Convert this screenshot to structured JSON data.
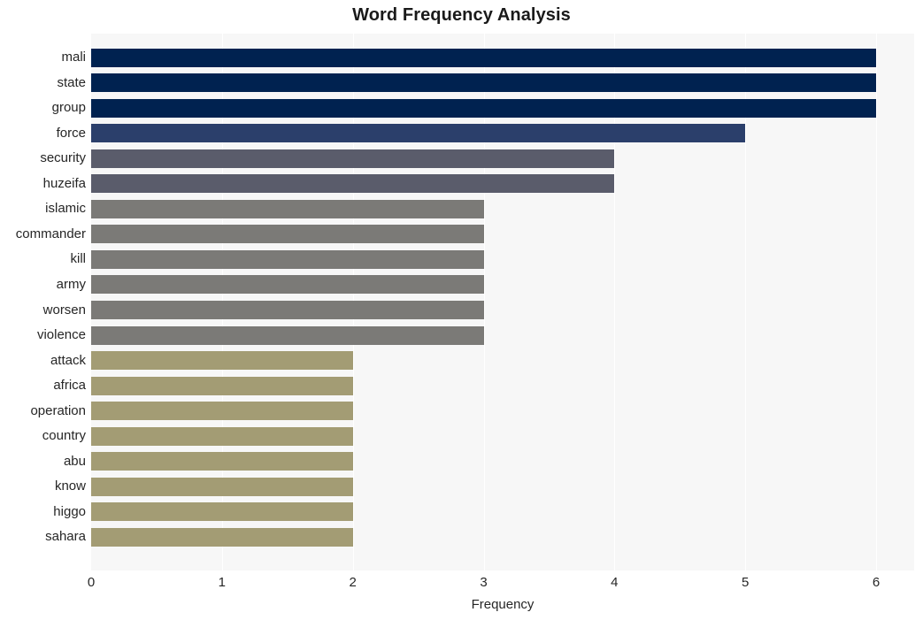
{
  "chart_data": {
    "type": "bar",
    "orientation": "horizontal",
    "title": "Word Frequency Analysis",
    "xlabel": "Frequency",
    "ylabel": "",
    "xlim": [
      0,
      6
    ],
    "xticks": [
      0,
      1,
      2,
      3,
      4,
      5,
      6
    ],
    "xtick_labels": [
      "0",
      "1",
      "2",
      "3",
      "4",
      "5",
      "6"
    ],
    "grid": "vertical-white-gridlines",
    "legend": "none",
    "background": "#f7f7f7",
    "categories": [
      "mali",
      "state",
      "group",
      "force",
      "security",
      "huzeifa",
      "islamic",
      "commander",
      "kill",
      "army",
      "worsen",
      "violence",
      "attack",
      "africa",
      "operation",
      "country",
      "abu",
      "know",
      "higgo",
      "sahara"
    ],
    "values": [
      6,
      6,
      6,
      5,
      4,
      4,
      3,
      3,
      3,
      3,
      3,
      3,
      2,
      2,
      2,
      2,
      2,
      2,
      2,
      2
    ],
    "bar_colors": [
      "#002250",
      "#002250",
      "#002250",
      "#2b3f6b",
      "#5a5c6b",
      "#5a5c6b",
      "#7b7a77",
      "#7b7a77",
      "#7b7a77",
      "#7b7a77",
      "#7b7a77",
      "#7b7a77",
      "#a39c74",
      "#a39c74",
      "#a39c74",
      "#a39c74",
      "#a39c74",
      "#a39c74",
      "#a39c74",
      "#a39c74"
    ]
  }
}
